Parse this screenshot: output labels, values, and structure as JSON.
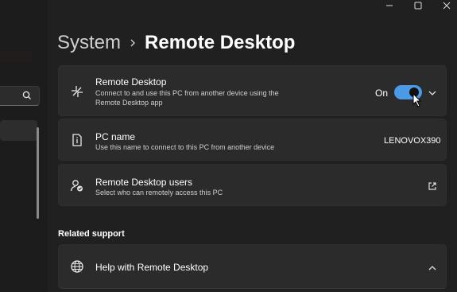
{
  "window": {
    "minimize_icon": "minimize-icon",
    "maximize_icon": "maximize-icon",
    "close_icon": "close-icon"
  },
  "sidebar": {
    "search_icon": "search-icon"
  },
  "header": {
    "parent": "System",
    "separator_icon": "chevron-right-icon",
    "current": "Remote Desktop"
  },
  "remote_desktop": {
    "title": "Remote Desktop",
    "description_line1": "Connect to and use this PC from another device using the",
    "description_line2": "Remote Desktop app",
    "state_label": "On",
    "toggle_on": true,
    "accent_color": "#4a9ae8"
  },
  "pc_name": {
    "title": "PC name",
    "description": "Use this name to connect to this PC from another device",
    "value": "LENOVOX390"
  },
  "users": {
    "title": "Remote Desktop users",
    "description": "Select who can remotely access this PC"
  },
  "related_support": {
    "heading": "Related support",
    "help_title": "Help with Remote Desktop"
  },
  "colors": {
    "background": "#202020",
    "card": "#2b2b2b",
    "text": "#ffffff",
    "secondary_text": "#cfcfcf"
  }
}
